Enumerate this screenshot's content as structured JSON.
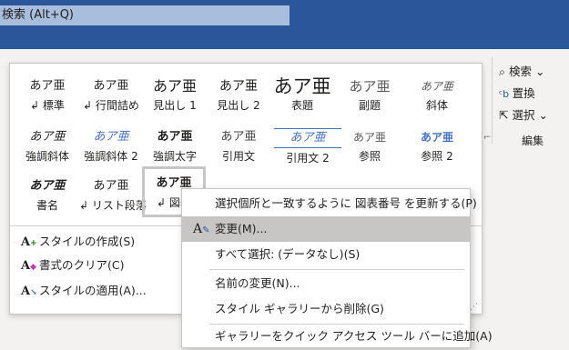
{
  "titlebar": {
    "search": "検索 (Alt+Q)"
  },
  "styles": [
    {
      "preview": "あア亜",
      "label": "標準",
      "linked": true
    },
    {
      "preview": "あア亜",
      "label": "行間詰め",
      "linked": true
    },
    {
      "preview": "あア亜",
      "label": "見出し 1",
      "linked": false
    },
    {
      "preview": "あア亜",
      "label": "見出し 2",
      "linked": false
    },
    {
      "preview": "あア亜",
      "label": "表題",
      "linked": false
    },
    {
      "preview": "あア亜",
      "label": "副題",
      "linked": false
    },
    {
      "preview": "あア亜",
      "label": "斜体",
      "linked": false
    },
    {
      "preview": "あア亜",
      "label": "強調斜体",
      "linked": false
    },
    {
      "preview": "あア亜",
      "label": "強調斜体 2",
      "linked": false
    },
    {
      "preview": "あア亜",
      "label": "強調太字",
      "linked": false
    },
    {
      "preview": "あア亜",
      "label": "引用文",
      "linked": false
    },
    {
      "preview": "あア亜",
      "label": "引用文 2",
      "linked": false
    },
    {
      "preview": "あア亜",
      "label": "参照",
      "linked": false
    },
    {
      "preview": "あア亜",
      "label": "参照 2",
      "linked": false
    },
    {
      "preview": "あア亜",
      "label": "書名",
      "linked": false
    },
    {
      "preview": "あア亜",
      "label": "リスト段落",
      "linked": true
    },
    {
      "preview": "あア亜",
      "label": "図表",
      "linked": true
    }
  ],
  "gallery_commands": {
    "create_style": "スタイルの作成(S)",
    "clear_format": "書式のクリア(C)",
    "apply_style": "スタイルの適用(A)..."
  },
  "ribbon_right": {
    "search": "検索",
    "replace": "置換",
    "select": "選択",
    "group_label": "編集"
  },
  "context_menu": {
    "update": "選択個所と一致するように 図表番号 を更新する(P)",
    "modify": "変更(M)...",
    "select_all": "すべて選択: (データなし)(S)",
    "rename": "名前の変更(N)...",
    "remove": "スタイル ギャラリーから削除(G)",
    "add_qat": "ギャラリーをクイック アクセス ツール バーに追加(A)"
  }
}
